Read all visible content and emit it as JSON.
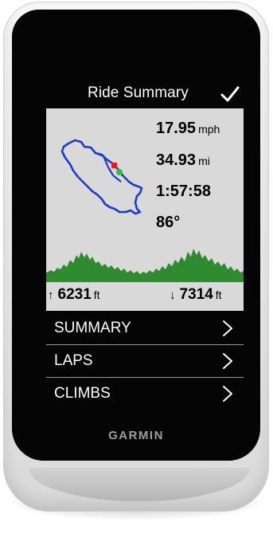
{
  "header": {
    "title": "Ride Summary",
    "confirm_icon": "checkmark-icon"
  },
  "stats": {
    "speed": {
      "value": "17.95",
      "unit": "mph"
    },
    "distance": {
      "value": "34.93",
      "unit": "mi"
    },
    "time": {
      "value": "1:57:58"
    },
    "temperature": {
      "value": "86°"
    }
  },
  "map": {
    "route_color": "#1a3ccf",
    "start_marker_color": "#e02020",
    "end_marker_color": "#2fbf3f",
    "icon": "route-map"
  },
  "elevation": {
    "profile_color": "#2e8b2e",
    "ascent": {
      "arrow": "↑",
      "value": "6231",
      "unit": "ft"
    },
    "descent": {
      "arrow": "↓",
      "value": "7314",
      "unit": "ft"
    }
  },
  "menu": {
    "items": [
      {
        "label": "SUMMARY",
        "icon": "chevron-right-icon"
      },
      {
        "label": "LAPS",
        "icon": "chevron-right-icon"
      },
      {
        "label": "CLIMBS",
        "icon": "chevron-right-icon"
      }
    ]
  },
  "device": {
    "brand": "GARMIN"
  },
  "colors": {
    "screen_bg": "#050505",
    "panel_bg": "#d9d9d9",
    "text_light": "#ffffff",
    "text_dark": "#000000",
    "brand_gray": "#9e9e9e"
  }
}
